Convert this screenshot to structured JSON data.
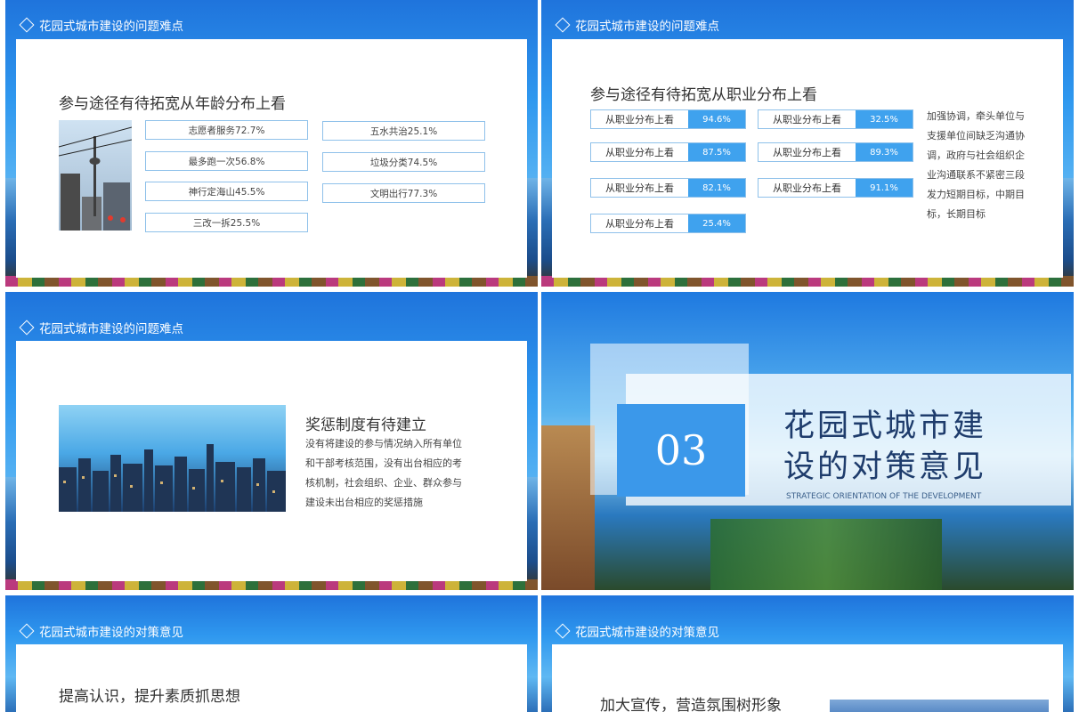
{
  "colors": {
    "accent": "#3fa2ee",
    "border": "#8fc1ea",
    "sky": "#2f98ef"
  },
  "slide1": {
    "section": "花园式城市建设的问题难点",
    "heading": "参与途径有待拓宽从年龄分布上看",
    "left_items": [
      "志愿者服务72.7%",
      "最多跑一次56.8%",
      "神行定海山45.5%",
      "三改一拆25.5%"
    ],
    "right_items": [
      "五水共治25.1%",
      "垃圾分类74.5%",
      "文明出行77.3%"
    ]
  },
  "slide2": {
    "section": "花园式城市建设的问题难点",
    "heading": "参与途径有待拓宽从职业分布上看",
    "bars": [
      {
        "label": "从职业分布上看",
        "value": "94.6%"
      },
      {
        "label": "从职业分布上看",
        "value": "32.5%"
      },
      {
        "label": "从职业分布上看",
        "value": "87.5%"
      },
      {
        "label": "从职业分布上看",
        "value": "89.3%"
      },
      {
        "label": "从职业分布上看",
        "value": "82.1%"
      },
      {
        "label": "从职业分布上看",
        "value": "91.1%"
      },
      {
        "label": "从职业分布上看",
        "value": "25.4%"
      }
    ],
    "side_text": [
      "加强协调，牵头单位与",
      "支援单位间缺乏沟通协",
      "调，政府与社会组织企",
      "业沟通联系不紧密三段",
      "发力短期目标，中期目",
      "标，长期目标"
    ]
  },
  "slide3": {
    "section": "花园式城市建设的问题难点",
    "heading": "奖惩制度有待建立",
    "body": [
      "没有将建设的参与情况纳入所有单位",
      "和干部考核范围，没有出台相应的考",
      "核机制，社会组织、企业、群众参与",
      "建设未出台相应的奖惩措施"
    ]
  },
  "slide4": {
    "number": "03",
    "title_line1": "花园式城市建",
    "title_line2": "设的对策意见",
    "subtitle": "STRATEGIC ORIENTATION OF THE DEVELOPMENT"
  },
  "slide5": {
    "section": "花园式城市建设的对策意见",
    "heading": "提高认识，提升素质抓思想"
  },
  "slide6": {
    "section": "花园式城市建设的对策意见",
    "heading": "加大宣传，营造氛围树形象"
  }
}
